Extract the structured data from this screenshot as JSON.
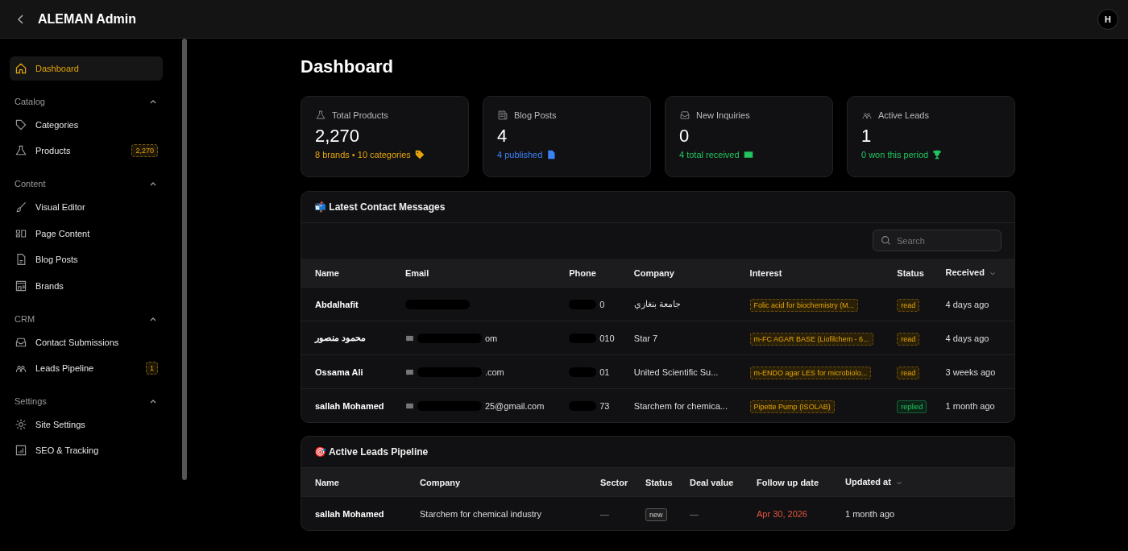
{
  "header": {
    "title": "ALEMAN Admin",
    "avatar": "H"
  },
  "sidebar": {
    "top": {
      "label": "Dashboard",
      "selected": true
    },
    "groups": [
      {
        "title": "Catalog",
        "expanded": true,
        "items": [
          {
            "label": "Categories",
            "selected": false
          },
          {
            "label": "Products",
            "selected": false,
            "badge": "2,270"
          }
        ]
      },
      {
        "title": "Content",
        "expanded": true,
        "items": [
          {
            "label": "Visual Editor",
            "selected": false
          },
          {
            "label": "Page Content",
            "selected": false
          },
          {
            "label": "Blog Posts",
            "selected": false
          },
          {
            "label": "Brands",
            "selected": false
          }
        ]
      },
      {
        "title": "CRM",
        "expanded": true,
        "items": [
          {
            "label": "Contact Submissions",
            "selected": false
          },
          {
            "label": "Leads Pipeline",
            "selected": false,
            "badge": "1"
          }
        ]
      },
      {
        "title": "Settings",
        "expanded": true,
        "items": [
          {
            "label": "Site Settings",
            "selected": false
          },
          {
            "label": "SEO & Tracking",
            "selected": false
          }
        ]
      }
    ]
  },
  "page_title": "Dashboard",
  "stats": [
    {
      "label": "Total Products",
      "value": "2,270",
      "note": "8 brands • 10 categories",
      "color": "#e5a50a"
    },
    {
      "label": "Blog Posts",
      "value": "4",
      "note": "4 published",
      "color": "#3b82f6"
    },
    {
      "label": "New Inquiries",
      "value": "0",
      "note": "4 total received",
      "color": "#22c55e"
    },
    {
      "label": "Active Leads",
      "value": "1",
      "note": "0 won this period",
      "color": "#22c55e"
    }
  ],
  "messages": {
    "title": "📬 Latest Contact Messages",
    "search": {
      "placeholder": "Search"
    },
    "columns": [
      "Name",
      "Email",
      "Phone",
      "Company",
      "Interest",
      "Status",
      "Received"
    ],
    "rows": [
      {
        "name": "Abdalhafit",
        "email": "",
        "phone": "0",
        "company": "جامعة بنغازي",
        "interest": "Folic acid for biochemistry (M...",
        "status": "read",
        "received": "4 days ago"
      },
      {
        "name": "محمود منصور",
        "email": "om",
        "phone": "010",
        "company": "Star 7",
        "interest": "m-FC AGAR BASE (Liofilchem - 6...",
        "status": "read",
        "received": "4 days ago"
      },
      {
        "name": "Ossama Ali",
        "email": ".com",
        "phone": "01",
        "company": "United Scientific Su...",
        "interest": "m-ENDO agar LES for microbiolo...",
        "status": "read",
        "received": "3 weeks ago"
      },
      {
        "name": "sallah Mohamed",
        "email": "25@gmail.com",
        "phone": "73",
        "company": "Starchem for chemica...",
        "interest": "Pipette Pump (ISOLAB)",
        "status": "replied",
        "received": "1 month ago"
      }
    ]
  },
  "leads": {
    "title": "🎯 Active Leads Pipeline",
    "columns": [
      "Name",
      "Company",
      "Sector",
      "Status",
      "Deal value",
      "Follow up date",
      "Updated at"
    ],
    "rows": [
      {
        "name": "sallah Mohamed",
        "company": "Starchem for chemical industry",
        "sector": "—",
        "status": "new",
        "deal_value": "—",
        "follow_up": "Apr 30, 2026",
        "updated": "1 month ago"
      }
    ]
  }
}
